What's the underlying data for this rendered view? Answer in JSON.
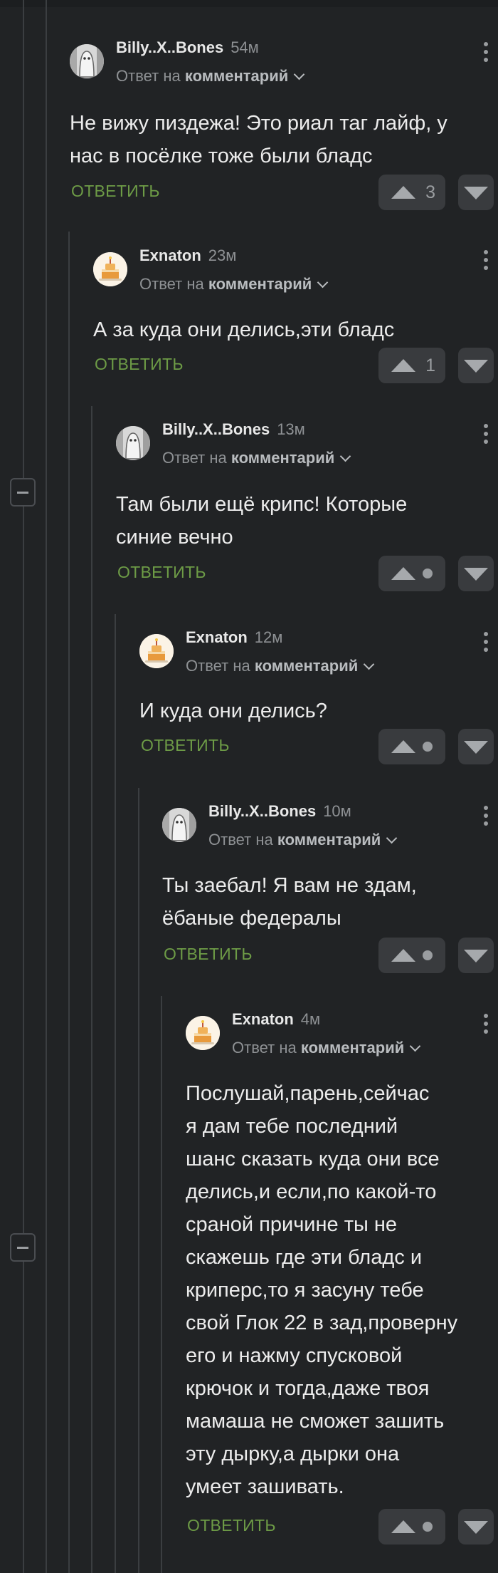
{
  "ui": {
    "reply_to_prefix": "Ответ на",
    "reply_to_target": "комментарий",
    "reply_button": "ОТВЕТИТЬ",
    "colors": {
      "background": "#212325",
      "reply_accent": "#6d9b46",
      "muted": "#8e9194"
    }
  },
  "comments": [
    {
      "author": "Billy..X..Bones",
      "time": "54м",
      "avatar_icon": "ghost-avatar-icon",
      "lines": [
        "Не вижу пиздежа! Это риал таг лайф, у",
        "нас в посёлке тоже были бладс"
      ],
      "score": "3"
    },
    {
      "author": "Exnaton",
      "time": "23м",
      "avatar_icon": "cake-avatar-icon",
      "lines": [
        "А за куда они делись,эти бладс"
      ],
      "score": "1"
    },
    {
      "author": "Billy..X..Bones",
      "time": "13м",
      "avatar_icon": "ghost-avatar-icon",
      "lines": [
        "Там были ещё крипс! Которые",
        "синие вечно"
      ],
      "score": null
    },
    {
      "author": "Exnaton",
      "time": "12м",
      "avatar_icon": "cake-avatar-icon",
      "lines": [
        "И куда они делись?"
      ],
      "score": null
    },
    {
      "author": "Billy..X..Bones",
      "time": "10м",
      "avatar_icon": "ghost-avatar-icon",
      "lines": [
        "Ты заебал! Я вам не здам,",
        "ёбаные федералы"
      ],
      "score": null
    },
    {
      "author": "Exnaton",
      "time": "4м",
      "avatar_icon": "cake-avatar-icon",
      "lines": [
        "Послушай,парень,сейчас",
        "я дам тебе последний",
        "шанс сказать куда они все",
        "делись,и если,по какой-то",
        "сраной причине ты не",
        "скажешь где эти бладс и",
        "криперс,то я засуну тебе",
        "свой Глок 22 в зад,проверну",
        "его и нажму спусковой",
        "крючок и тогда,даже твоя",
        "мамаша не сможет зашить",
        "эту дырку,а дырки она",
        "умеет зашивать."
      ],
      "score": null
    }
  ]
}
